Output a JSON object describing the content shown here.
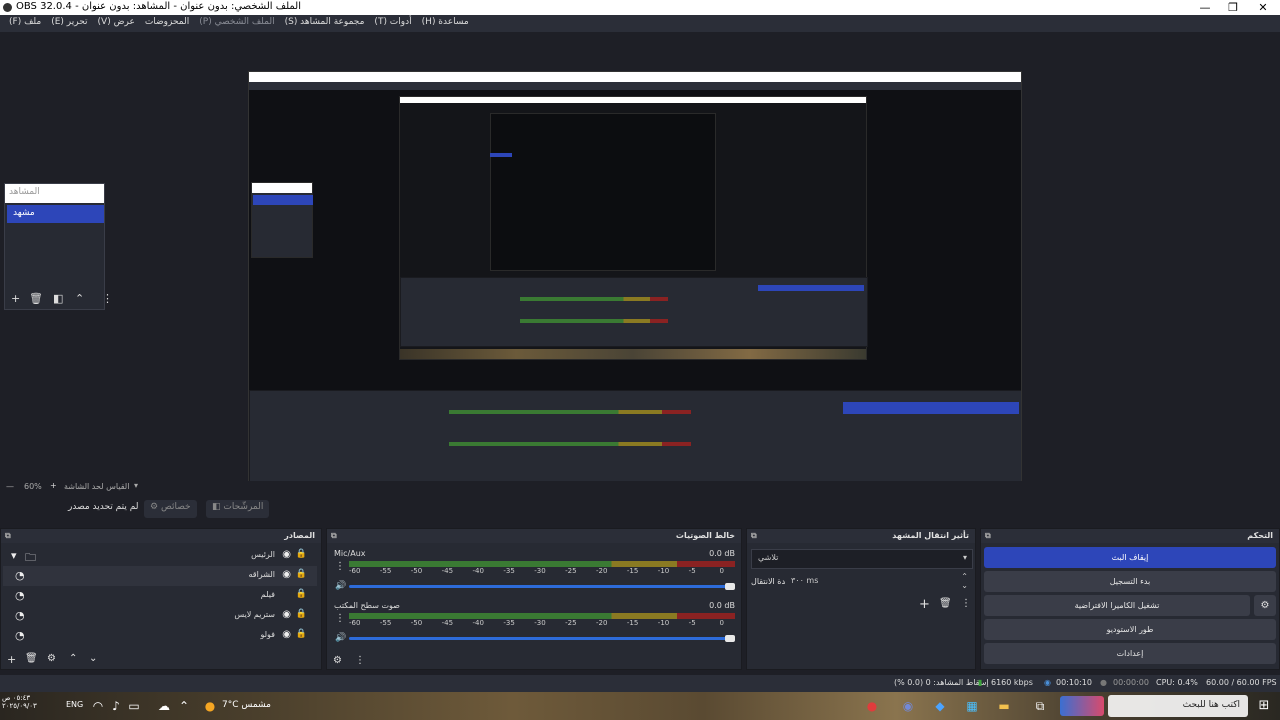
{
  "window": {
    "title": "OBS 32.0.4 - الملف الشخصي: بدون عنوان - المشاهد: بدون عنوان",
    "minimize": "—",
    "maximize": "❐",
    "close": "✕"
  },
  "menu": [
    "ملف (F)",
    "تحرير (E)",
    "عرض (V)",
    "المحزوضات",
    "الملف الشخصي (P)",
    "مجموعة المشاهد (S)",
    "أدوات (T)",
    "مساعدة (H)"
  ],
  "scenes_dock": {
    "header": "المشاهد",
    "scene": "مشهد"
  },
  "zoom": {
    "value": "60%",
    "plus": "+",
    "minus": "—",
    "label": "القياس لحد الشاشة"
  },
  "context": {
    "no_source": "لم يتم تحديد مصدر",
    "properties": "خصائص",
    "filters": "المرشّحات"
  },
  "sources": {
    "title": "المصادر",
    "items": [
      {
        "name": "الرئيس",
        "icon": "folder-icon"
      },
      {
        "name": "الشراقه",
        "icon": "screen-capture-icon"
      },
      {
        "name": "فيلم",
        "icon": "screen-capture-icon"
      },
      {
        "name": "ستريم لايس",
        "icon": "screen-capture-icon"
      },
      {
        "name": "فولو",
        "icon": "screen-capture-icon"
      }
    ]
  },
  "mixer": {
    "title": "خالط الصوتيات",
    "tracks": [
      {
        "name": "Mic/Aux",
        "db": "0.0 dB"
      },
      {
        "name": "صوت سطح المكتب",
        "db": "0.0 dB"
      }
    ],
    "ticks": [
      "-60",
      "-55",
      "-50",
      "-45",
      "-40",
      "-35",
      "-30",
      "-25",
      "-20",
      "-15",
      "-10",
      "-5",
      "0"
    ]
  },
  "transitions": {
    "title": "تأثير انتقال المشهد",
    "selected": "تلاشي",
    "duration_label": "مدة الانتقال",
    "duration_value": "٣٠٠ ms"
  },
  "controls": {
    "title": "التحكم",
    "buttons": [
      "إيقاف البث",
      "بدء التسجيل",
      "تشغيل الكاميرا الافتراضية",
      "طور الاستوديو",
      "إعدادات"
    ]
  },
  "status": {
    "dropped": "إسقاط المشاهد: 0 (0.0 %)",
    "bitrate": "6160 kbps",
    "stream_time": "00:10:10",
    "rec_time": "00:00:00",
    "cpu": "CPU: 0.4%",
    "fps": "60.00 / 60.00 FPS"
  },
  "taskbar": {
    "search": "اكتب هنا للبحث",
    "weather": "7°C مشمس",
    "lang": "ENG",
    "clock_time": "٠٥:٤٣ ص",
    "clock_date": "٢٠٢٥/٠٩/٠٣"
  },
  "colors": {
    "accent": "#2d46b9",
    "dock_bg": "#272a33",
    "meter_green": "#3a7a33",
    "meter_yellow": "#8a7a22",
    "meter_red": "#8a2222"
  }
}
